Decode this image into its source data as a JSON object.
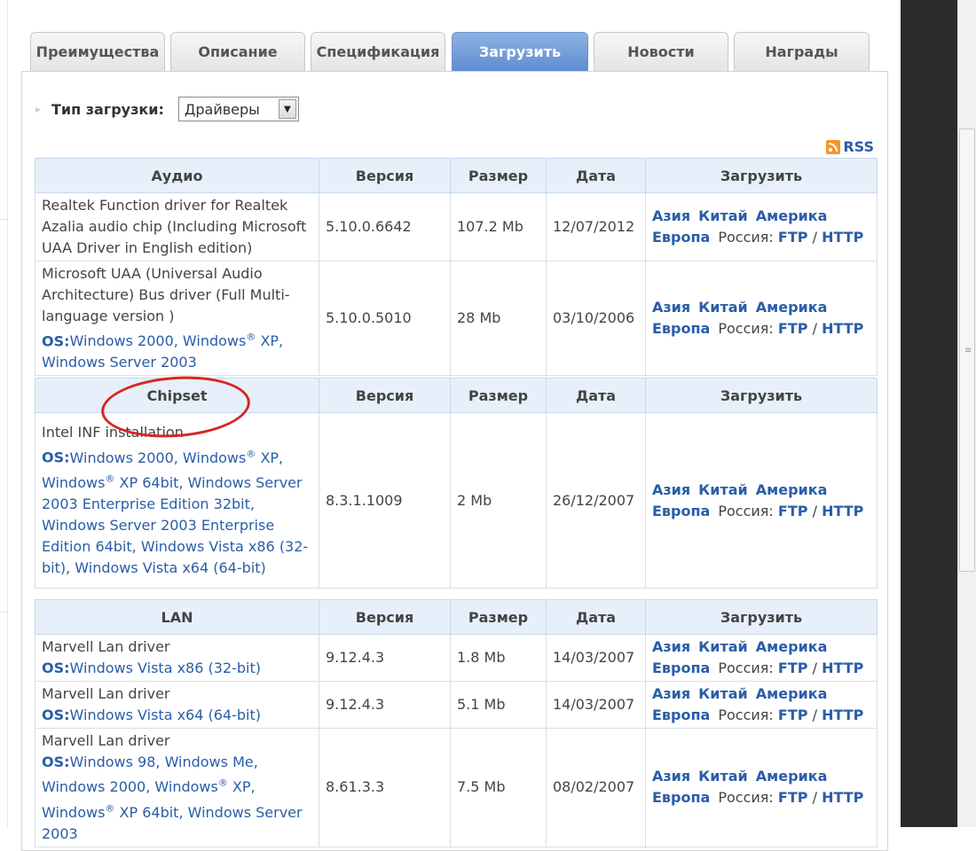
{
  "tabs": [
    {
      "label": "Преимущества",
      "active": false
    },
    {
      "label": "Описание",
      "active": false
    },
    {
      "label": "Спецификация",
      "active": false
    },
    {
      "label": "Загрузить",
      "active": true
    },
    {
      "label": "Новости",
      "active": false
    },
    {
      "label": "Награды",
      "active": false
    }
  ],
  "download_type": {
    "label": "Тип загрузки:",
    "selected": "Драйверы"
  },
  "rss_label": "RSS",
  "columns": {
    "version": "Версия",
    "size": "Размер",
    "date": "Дата",
    "download": "Загрузить"
  },
  "mirrors": {
    "asia": "Азия",
    "china": "Китай",
    "america": "Америка",
    "europe": "Европа",
    "russia": "Россия:",
    "ftp": "FTP",
    "slash": "/",
    "http": "HTTP"
  },
  "os_prefix": "OS:",
  "sections": [
    {
      "title": "Аудио",
      "rows": [
        {
          "name": "Realtek Function driver for Realtek Azalia audio chip (Including Microsoft UAA Driver in English edition)",
          "os": "",
          "version": "5.10.0.6642",
          "size": "107.2 Mb",
          "date": "12/07/2012"
        },
        {
          "name": "Microsoft UAA (Universal Audio Architecture) Bus driver (Full Multi-language version )",
          "os": "Windows 2000, Windows® XP, Windows Server 2003",
          "version": "5.10.0.5010",
          "size": "28 Mb",
          "date": "03/10/2006"
        }
      ]
    },
    {
      "title": "Chipset",
      "rows": [
        {
          "name": "Intel INF installation",
          "os": "Windows 2000, Windows® XP, Windows® XP 64bit, Windows Server 2003 Enterprise Edition 32bit, Windows Server 2003 Enterprise Edition 64bit, Windows Vista x86 (32-bit), Windows Vista x64 (64-bit)",
          "version": "8.3.1.1009",
          "size": "2 Mb",
          "date": "26/12/2007"
        }
      ]
    },
    {
      "title": "LAN",
      "rows": [
        {
          "name": "Marvell Lan driver",
          "os": "Windows Vista x86 (32-bit)",
          "version": "9.12.4.3",
          "size": "1.8 Mb",
          "date": "14/03/2007"
        },
        {
          "name": "Marvell Lan driver",
          "os": "Windows Vista x64 (64-bit)",
          "version": "9.12.4.3",
          "size": "5.1 Mb",
          "date": "14/03/2007"
        },
        {
          "name": "Marvell Lan driver",
          "os": "Windows 98, Windows Me, Windows 2000, Windows® XP, Windows® XP 64bit, Windows Server 2003",
          "version": "8.61.3.3",
          "size": "7.5 Mb",
          "date": "08/02/2007"
        }
      ]
    }
  ]
}
